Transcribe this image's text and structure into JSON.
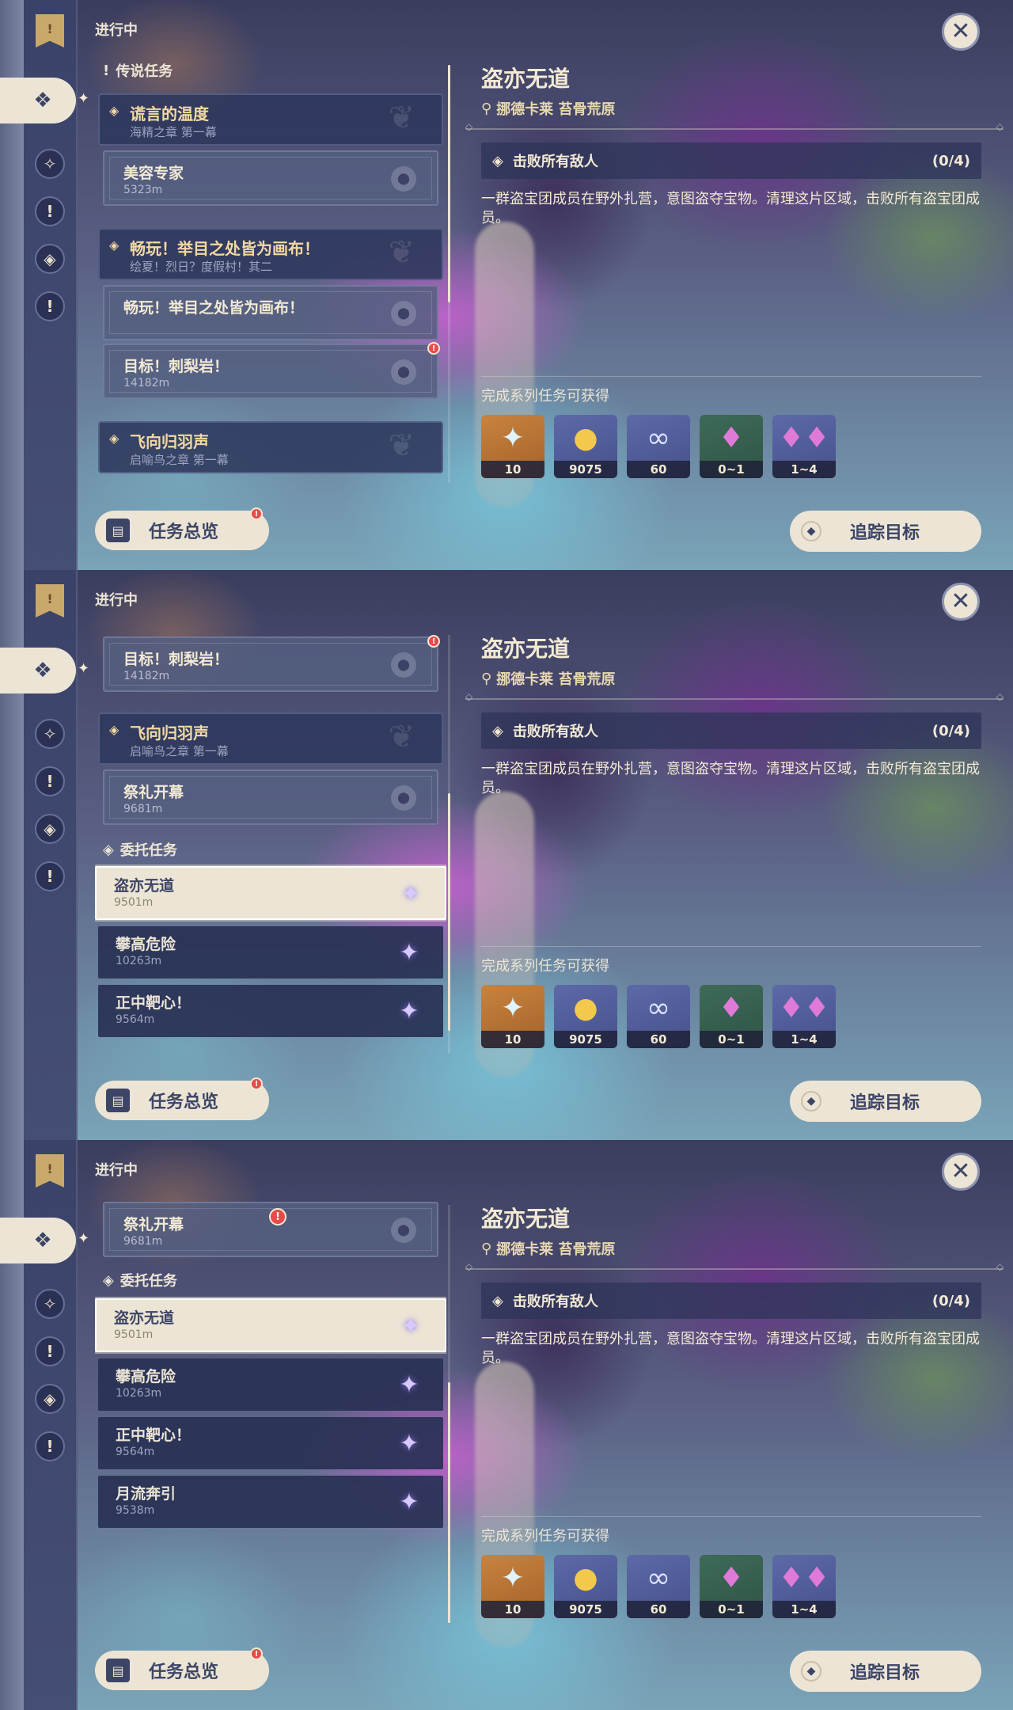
{
  "screens": [
    {
      "status": "进行中",
      "quest_title": "盗亦无道",
      "quest_location": "挪德卡莱 苔骨荒原",
      "objective": {
        "text": "击败所有敌人",
        "count": "(0/4)"
      },
      "description": "一群盗宝团成员在野外扎营，意图盗夺宝物。清理这片区域，击败所有盗宝团成员。",
      "rewards_label": "完成系列任务可获得",
      "rewards": [
        {
          "icon": "primogem-icon",
          "count": "10"
        },
        {
          "icon": "mora-icon",
          "count": "9075"
        },
        {
          "icon": "exp-icon",
          "count": "60"
        },
        {
          "icon": "crystal-icon",
          "count": "0~1"
        },
        {
          "icon": "crystal-cluster-icon",
          "count": "1~4"
        }
      ],
      "overview_label": "任务总览",
      "track_label": "追踪目标",
      "list": {
        "section_legend": "传说任务",
        "q1_title": "谎言的温度",
        "q1_sub": "海精之章 第一幕",
        "q1_item_title": "美容专家",
        "q1_item_dist": "5323m",
        "q2_title": "畅玩！举目之处皆为画布！",
        "q2_sub": "绘夏！烈日？度假村！其二",
        "q2_item1_title": "畅玩！举目之处皆为画布！",
        "q2_item2_title": "目标！刺梨岩！",
        "q2_item2_dist": "14182m",
        "q3_title": "飞向归羽声",
        "q3_sub": "启喻鸟之章 第一幕"
      }
    },
    {
      "status": "进行中",
      "quest_title": "盗亦无道",
      "quest_location": "挪德卡莱 苔骨荒原",
      "objective": {
        "text": "击败所有敌人",
        "count": "(0/4)"
      },
      "description": "一群盗宝团成员在野外扎营，意图盗夺宝物。清理这片区域，击败所有盗宝团成员。",
      "rewards_label": "完成系列任务可获得",
      "rewards": [
        {
          "icon": "primogem-icon",
          "count": "10"
        },
        {
          "icon": "mora-icon",
          "count": "9075"
        },
        {
          "icon": "exp-icon",
          "count": "60"
        },
        {
          "icon": "crystal-icon",
          "count": "0~1"
        },
        {
          "icon": "crystal-cluster-icon",
          "count": "1~4"
        }
      ],
      "overview_label": "任务总览",
      "track_label": "追踪目标",
      "list": {
        "item_a_title": "目标！刺梨岩！",
        "item_a_dist": "14182m",
        "q3_title": "飞向归羽声",
        "q3_sub": "启喻鸟之章 第一幕",
        "q3_item_title": "祭礼开幕",
        "q3_item_dist": "9681m",
        "section_commission": "委托任务",
        "c1_title": "盗亦无道",
        "c1_dist": "9501m",
        "c2_title": "攀高危险",
        "c2_dist": "10263m",
        "c3_title": "正中靶心！",
        "c3_dist": "9564m"
      }
    },
    {
      "status": "进行中",
      "quest_title": "盗亦无道",
      "quest_location": "挪德卡莱 苔骨荒原",
      "objective": {
        "text": "击败所有敌人",
        "count": "(0/4)"
      },
      "description": "一群盗宝团成员在野外扎营，意图盗夺宝物。清理这片区域，击败所有盗宝团成员。",
      "rewards_label": "完成系列任务可获得",
      "rewards": [
        {
          "icon": "primogem-icon",
          "count": "10"
        },
        {
          "icon": "mora-icon",
          "count": "9075"
        },
        {
          "icon": "exp-icon",
          "count": "60"
        },
        {
          "icon": "crystal-icon",
          "count": "0~1"
        },
        {
          "icon": "crystal-cluster-icon",
          "count": "1~4"
        }
      ],
      "overview_label": "任务总览",
      "track_label": "追踪目标",
      "list": {
        "q3_item_title": "祭礼开幕",
        "q3_item_dist": "9681m",
        "section_commission": "委托任务",
        "c1_title": "盗亦无道",
        "c1_dist": "9501m",
        "c2_title": "攀高危险",
        "c2_dist": "10263m",
        "c3_title": "正中靶心！",
        "c3_dist": "9564m",
        "c4_title": "月流奔引",
        "c4_dist": "9538m"
      }
    }
  ],
  "colors": {
    "accent": "#ece5d5",
    "panel": "#2e385c",
    "alert": "#e84a4a",
    "quest_gold": "#f2d9a2"
  }
}
